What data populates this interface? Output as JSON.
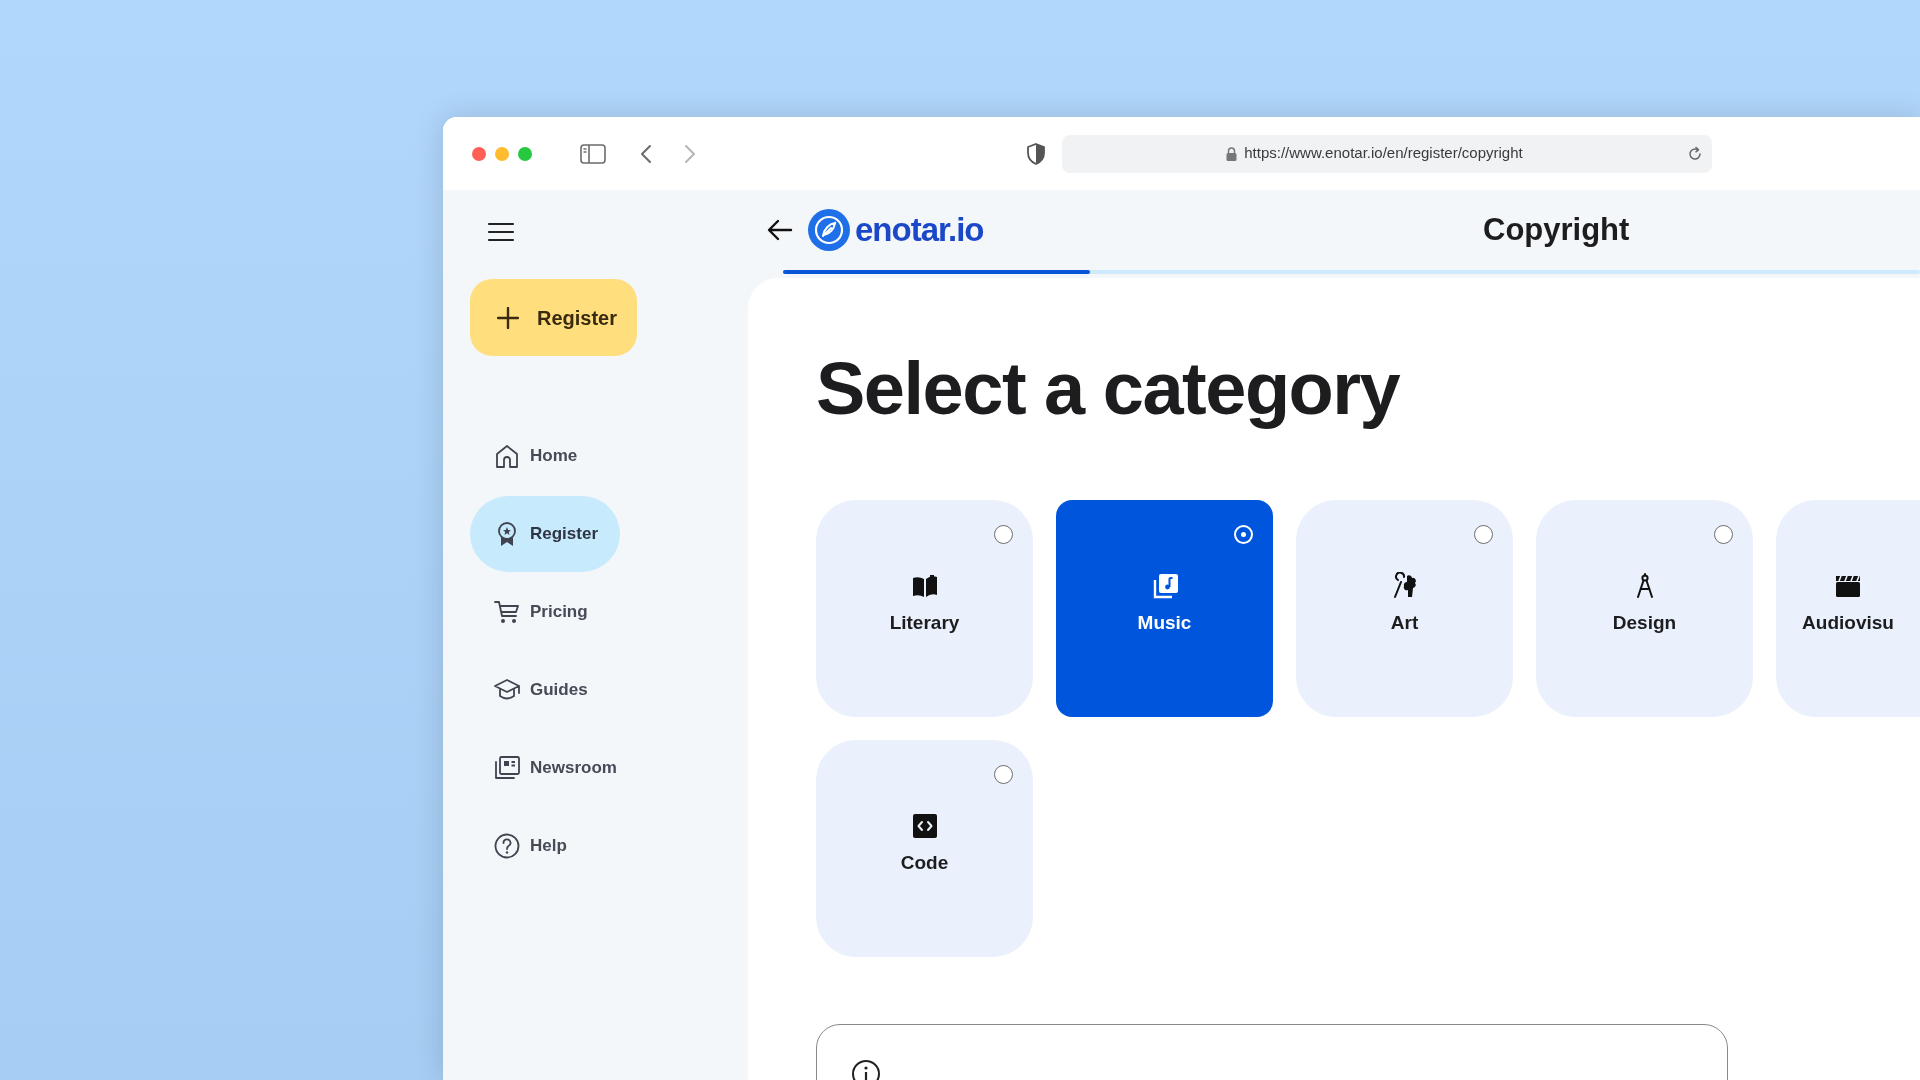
{
  "browser": {
    "url": "https://www.enotar.io/en/register/copyright"
  },
  "sidebar": {
    "register_button": "Register",
    "items": [
      {
        "label": "Home",
        "kind": "home",
        "selected": false
      },
      {
        "label": "Register",
        "kind": "award",
        "selected": true
      },
      {
        "label": "Pricing",
        "kind": "cart",
        "selected": false
      },
      {
        "label": "Guides",
        "kind": "cap",
        "selected": false
      },
      {
        "label": "Newsroom",
        "kind": "news",
        "selected": false
      },
      {
        "label": "Help",
        "kind": "help",
        "selected": false
      }
    ]
  },
  "header": {
    "logo": "enotar.io",
    "title": "Copyright",
    "progress": {
      "level": 0.27
    }
  },
  "heading": "Select a category",
  "category_rows": [
    [
      {
        "label": "Literary",
        "kind": "book",
        "selected": false
      },
      {
        "label": "Music",
        "kind": "music",
        "selected": true
      },
      {
        "label": "Art",
        "kind": "art",
        "selected": false
      },
      {
        "label": "Design",
        "kind": "compass",
        "selected": false
      },
      {
        "label": "Audiovisu",
        "kind": "clapper",
        "selected": false
      }
    ],
    [
      {
        "label": "Code",
        "kind": "code",
        "selected": false
      }
    ]
  ]
}
